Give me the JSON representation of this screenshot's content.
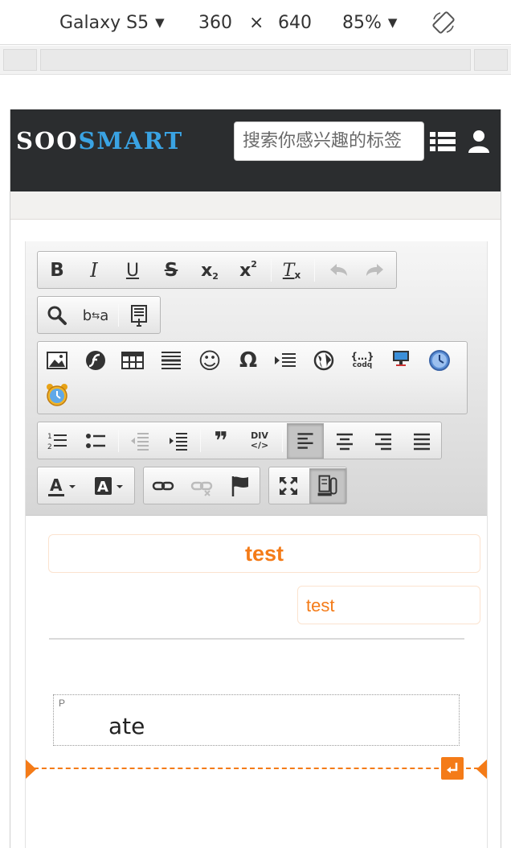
{
  "device_toolbar": {
    "device": "Galaxy S5",
    "width": "360",
    "times": "×",
    "height": "640",
    "zoom": "85%"
  },
  "navbar": {
    "logo_part1": "SOO",
    "logo_part2": "SMART",
    "search_placeholder": "搜索你感兴趣的标签",
    "background": "#2b2d2f",
    "accent": "#3aa3e3"
  },
  "toolbar": {
    "row1": [
      "bold",
      "italic",
      "underline",
      "strikethrough",
      "subscript",
      "superscript",
      "remove-format",
      "undo",
      "redo"
    ],
    "labels": {
      "bold": "B",
      "italic": "I",
      "underline": "U",
      "strike": "S",
      "sub": "x",
      "sup": "x",
      "sub_mark": "2",
      "sup_mark": "2",
      "remove": "T",
      "remove_mark": "x",
      "ba": "b",
      "ba2": "a",
      "div": "DIV",
      "div2": "</>",
      "quote": "❞",
      "omega": "Ω",
      "smiley": "☺",
      "codeq_top": "{…}",
      "codeq_bottom": "codq"
    },
    "icons": [
      "image-icon",
      "flash-icon",
      "table-icon",
      "horizontal-rule-icon",
      "smiley-icon",
      "omega-icon",
      "indent-block-icon",
      "globe-icon",
      "code-icon",
      "monitor-icon",
      "clock-icon",
      "alarm-clock-icon"
    ],
    "active": [
      "align-left",
      "show-blocks"
    ]
  },
  "editor": {
    "heading_text": "test",
    "sub_text": "test",
    "block_tag": "P",
    "paragraph_text": "ate",
    "accent": "#f47b18"
  }
}
